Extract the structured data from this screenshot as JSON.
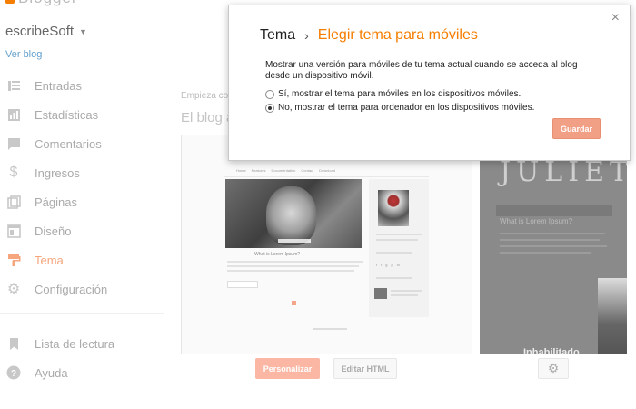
{
  "app": {
    "logo_text": "Blogger",
    "blog_name": "escribeSoft",
    "view_blog": "Ver blog"
  },
  "sidebar": {
    "items": [
      {
        "label": "Entradas",
        "icon": "posts-icon"
      },
      {
        "label": "Estadísticas",
        "icon": "stats-icon"
      },
      {
        "label": "Comentarios",
        "icon": "comments-icon"
      },
      {
        "label": "Ingresos",
        "icon": "earnings-icon"
      },
      {
        "label": "Páginas",
        "icon": "pages-icon"
      },
      {
        "label": "Diseño",
        "icon": "layout-icon"
      },
      {
        "label": "Tema",
        "icon": "theme-icon",
        "active": true
      },
      {
        "label": "Configuración",
        "icon": "gear-icon"
      }
    ],
    "secondary": [
      {
        "label": "Lista de lectura",
        "icon": "bookmark-icon"
      },
      {
        "label": "Ayuda",
        "icon": "help-icon"
      }
    ]
  },
  "main": {
    "starts_text": "Empieza co",
    "live_title": "El blog a",
    "preview_nav": [
      "Home",
      "Features",
      "Documentation",
      "Contact",
      "Download"
    ],
    "preview_post_title": "What is Lorem Ipsum?",
    "mobile_title": "JULIET",
    "mobile_sub": "What is Lorem Ipsum?",
    "mobile_disabled": "Inhabilitado",
    "customize_label": "Personalizar",
    "edit_html_label": "Editar HTML"
  },
  "dialog": {
    "title_root": "Tema",
    "separator": "›",
    "title_current": "Elegir tema para móviles",
    "description": "Mostrar una versión para móviles de tu tema actual cuando se acceda al blog desde un dispositivo móvil.",
    "options": [
      {
        "label": "Sí, mostrar el tema para móviles en los dispositivos móviles.",
        "checked": false
      },
      {
        "label": "No, mostrar el tema para ordenador en los dispositivos móviles.",
        "checked": true
      }
    ],
    "save_label": "Guardar",
    "close_label": "×"
  },
  "colors": {
    "accent": "#f57d00",
    "save_button": "#f2a085",
    "customize_button": "#fbb7a3",
    "link": "#64a0cc"
  }
}
